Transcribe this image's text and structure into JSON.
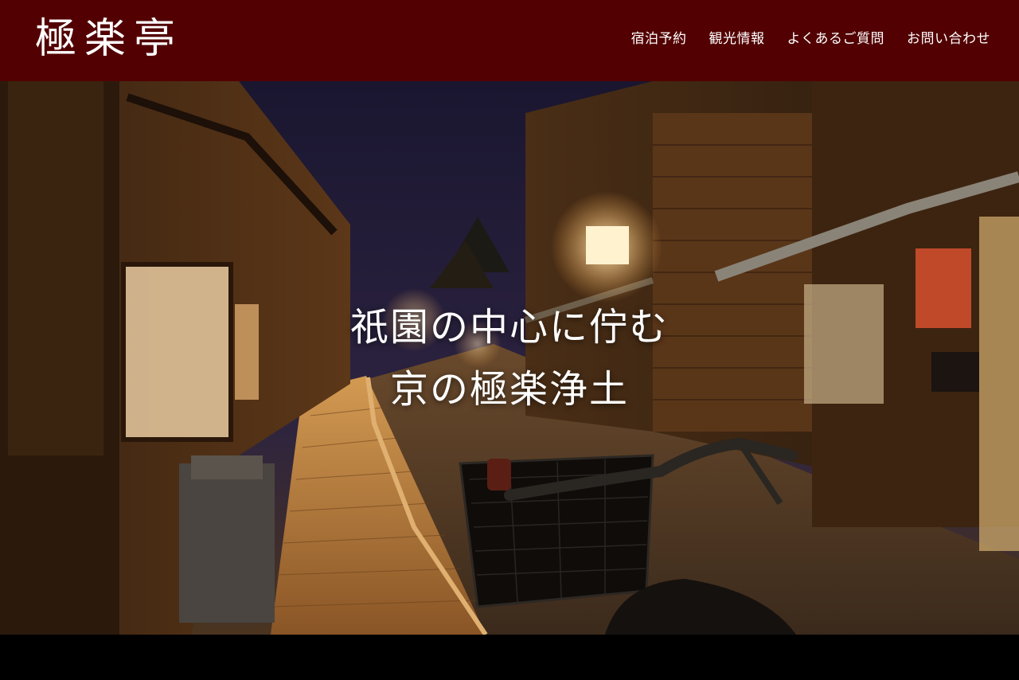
{
  "header": {
    "logo_text": "極楽亭",
    "nav": [
      {
        "label": "宿泊予約"
      },
      {
        "label": "観光情報"
      },
      {
        "label": "よくあるご質問"
      },
      {
        "label": "お問い合わせ"
      }
    ]
  },
  "hero": {
    "line1": "祇園の中心に佇む",
    "line2": "京の極楽浄土",
    "image_alt": "night-street-kyoto-photo"
  },
  "colors": {
    "header_bg": "#520002",
    "text": "#ffffff",
    "footer_bg": "#000000"
  }
}
